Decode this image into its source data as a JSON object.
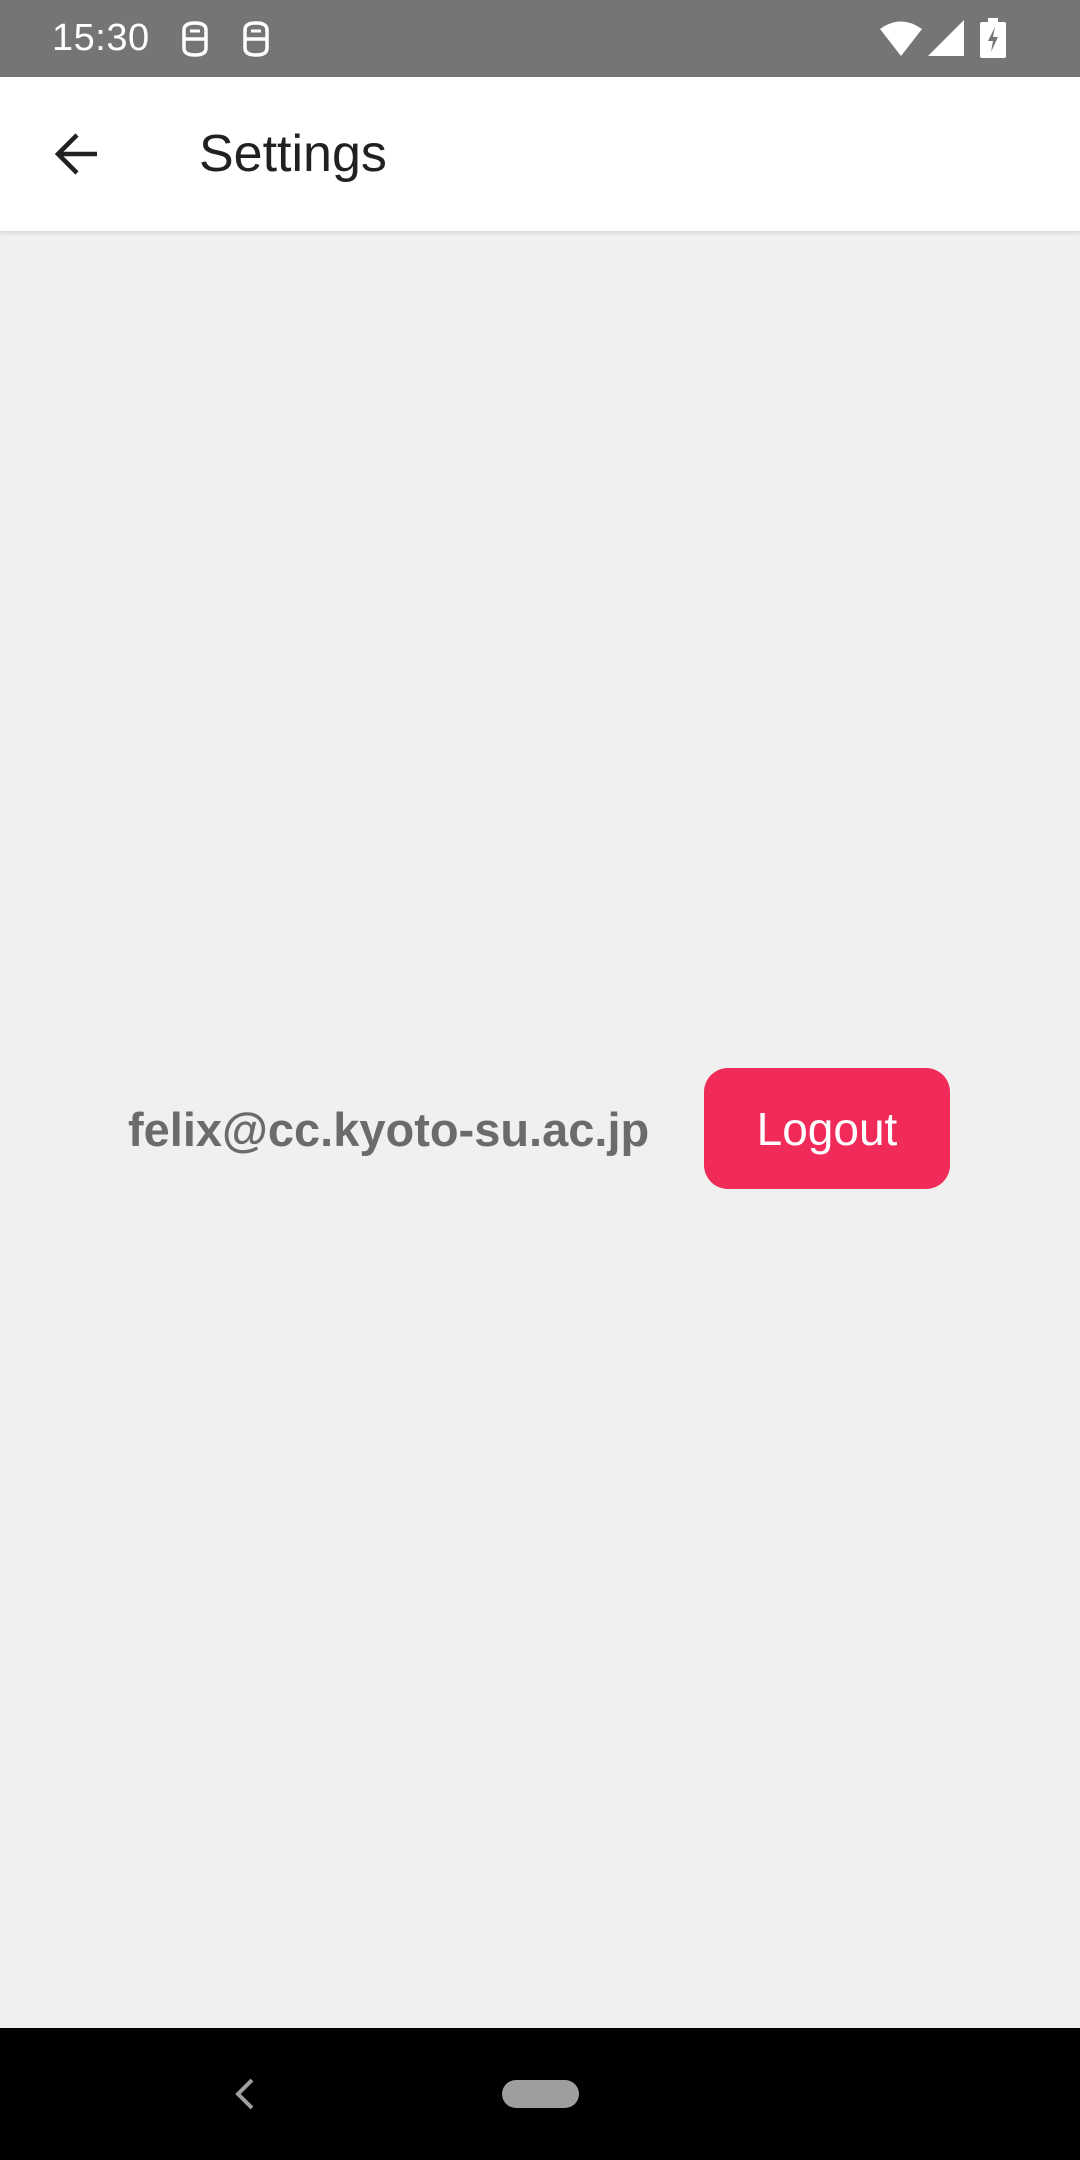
{
  "status_bar": {
    "time": "15:30",
    "notification_icons": [
      "app-notification-icon",
      "app-notification-icon"
    ],
    "right_icons": [
      "wifi-icon",
      "cell-signal-icon",
      "battery-charging-icon"
    ]
  },
  "app_bar": {
    "back_icon": "arrow-back-icon",
    "title": "Settings"
  },
  "account": {
    "email": "felix@cc.kyoto-su.ac.jp",
    "logout_label": "Logout"
  },
  "nav_bar": {
    "back_icon": "nav-back-icon",
    "home_icon": "nav-home-pill"
  },
  "colors": {
    "status_bar": "#757575",
    "app_bar": "#ffffff",
    "background": "#f0f0f0",
    "accent": "#f02b59",
    "email_text": "#6b6b6b",
    "nav_bar": "#000000"
  }
}
